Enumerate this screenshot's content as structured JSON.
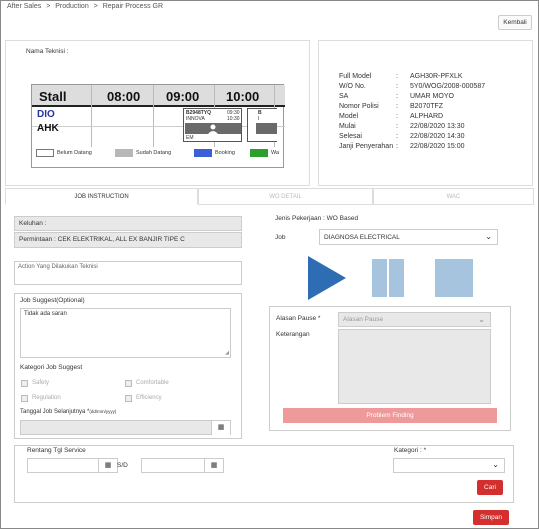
{
  "breadcrumb": [
    "After Sales",
    "Production",
    "Repair Process GR"
  ],
  "breadcrumb_sep": ">",
  "kembali_label": "Kembali",
  "nama_teknisi_label": "Nama Teknisi :",
  "schedule": {
    "stall_label": "Stall",
    "times": [
      "08:00",
      "09:00",
      "10:00"
    ],
    "rows": [
      "DIO",
      "AHK"
    ],
    "booking_card": {
      "plate": "B2948TYQ",
      "model": "INNOVA",
      "start": "09:30",
      "end": "10:30",
      "tech": "EM"
    },
    "legend": [
      "Belum Datang",
      "Sudah Datang",
      "Booking",
      "Wa"
    ]
  },
  "info": [
    {
      "label": "Full Model",
      "value": "AGH30R-PFXLK"
    },
    {
      "label": "W/O No.",
      "value": "5Y0/WOG/2008-000587"
    },
    {
      "label": "SA",
      "value": "UMAR MOYO"
    },
    {
      "label": "Nomor Polisi",
      "value": "B2070TFZ"
    },
    {
      "label": "Model",
      "value": "ALPHARD"
    },
    {
      "label": "Mulai",
      "value": "22/08/2020 13:30"
    },
    {
      "label": "Selesai",
      "value": "22/08/2020 14:30"
    },
    {
      "label": "Janji Penyerahan",
      "value": "22/08/2020 15:00"
    }
  ],
  "info_sep": ":",
  "tabs": [
    "JOB INSTRUCTION",
    "WO DETAIL",
    "WAC"
  ],
  "keluhan_label": "Keluhan :",
  "permintaan_text": "Permintaan : CEK ELEKTRIKAL, ALL EX BANJIR TIPE C",
  "action_placeholder": "Action Yang Dilakukan Teknisi",
  "job_suggest_label": "Job Suggest(Optional)",
  "job_suggest_value": "Tidak ada saran",
  "kategori_job_label": "Kategori Job Suggest",
  "checkboxes": [
    "Safety",
    "Comfortable",
    "Regulation",
    "Efficiency"
  ],
  "tanggal_label": "Tanggal Job Selanjutnya *",
  "tanggal_format": "(dd/mm/yyyy)",
  "jenis_pekerjaan": "Jenis Pekerjaan : WO Based",
  "job_label": "Job",
  "job_value": "DIAGNOSA ELECTRICAL",
  "alasan_pause_label": "Alasan Pause *",
  "alasan_pause_placeholder": "Alasan Pause",
  "keterangan_label": "Keterangan",
  "problem_finding_label": "Problem Finding",
  "rentang_label": "Rentang Tgl Service",
  "sd_label": "S/D",
  "kategori_label": "Kategori : *",
  "cari_label": "Cari",
  "simpan_label": "Simpan",
  "colors": {
    "play": "#2e6db4",
    "pause": "#a6c4de",
    "stop": "#a6c4de",
    "red": "#d32f2f",
    "booking": "#3b5fd9",
    "sudah": "#b8b8b8",
    "wait": "#2ca02c"
  }
}
